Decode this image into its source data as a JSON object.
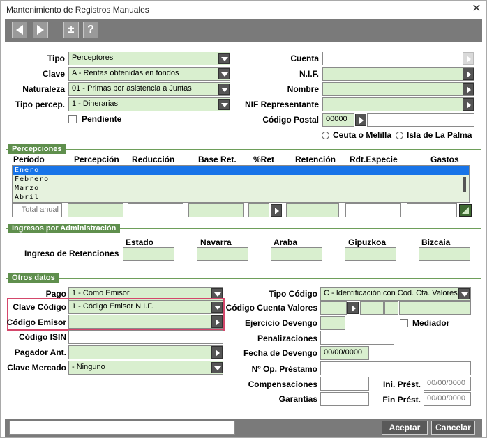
{
  "window": {
    "title": "Mantenimiento de Registros Manuales",
    "close_glyph": "✕"
  },
  "toolbar": {
    "prev_icon": "arrow-left-icon",
    "next_icon": "arrow-right-icon",
    "plusminus_label": "±",
    "help_label": "?"
  },
  "header": {
    "tipo": {
      "label": "Tipo",
      "value": "Perceptores"
    },
    "clave": {
      "label": "Clave",
      "value": "A - Rentas obtenidas en fondos"
    },
    "naturaleza": {
      "label": "Naturaleza",
      "value": "01 - Primas por asistencia a Juntas"
    },
    "tipo_percep": {
      "label": "Tipo percep.",
      "value": "1 - Dinerarias"
    },
    "pendiente": {
      "label": "Pendiente",
      "checked": false
    },
    "cuenta": {
      "label": "Cuenta",
      "value": ""
    },
    "nif": {
      "label": "N.I.F.",
      "value": ""
    },
    "nombre": {
      "label": "Nombre",
      "value": ""
    },
    "nif_representante": {
      "label": "NIF Representante",
      "value": ""
    },
    "codigo_postal": {
      "label": "Código Postal",
      "value": "00000",
      "extra": ""
    },
    "ceuta": {
      "label": "Ceuta o Melilla"
    },
    "palma": {
      "label": "Isla de La Palma"
    }
  },
  "percepciones": {
    "section_label": "Percepciones",
    "columns": [
      "Período",
      "Percepción",
      "Reducción",
      "Base Ret.",
      "%Ret",
      "Retención",
      "Rdt.Especie",
      "Gastos"
    ],
    "periods": [
      "Enero",
      "Febrero",
      "Marzo",
      "Abril"
    ],
    "selected_index": 0,
    "total_label": "Total anual"
  },
  "ingresos": {
    "section_label": "Ingresos por Administración",
    "row_label": "Ingreso de Retenciones",
    "columns": [
      "Estado",
      "Navarra",
      "Araba",
      "Gipuzkoa",
      "Bizcaia"
    ]
  },
  "otros": {
    "section_label": "Otros datos",
    "pago": {
      "label": "Pago",
      "value": "1 - Como Emisor"
    },
    "clave_codigo": {
      "label": "Clave Código",
      "value": "1 - Código Emisor N.I.F."
    },
    "codigo_emisor": {
      "label": "Código Emisor",
      "value": ""
    },
    "codigo_isin": {
      "label": "Código ISIN",
      "value": ""
    },
    "pagador_ant": {
      "label": "Pagador Ant.",
      "value": ""
    },
    "clave_mercado": {
      "label": "Clave Mercado",
      "value": "- Ninguno"
    },
    "tipo_codigo": {
      "label": "Tipo Código",
      "value": "C - Identificación con Cód. Cta. Valores"
    },
    "codigo_cuenta_valores": {
      "label": "Código Cuenta Valores"
    },
    "ejercicio_devengo": {
      "label": "Ejercicio Devengo",
      "value": ""
    },
    "mediador": {
      "label": "Mediador",
      "checked": false
    },
    "penalizaciones": {
      "label": "Penalizaciones",
      "value": ""
    },
    "fecha_devengo": {
      "label": "Fecha de Devengo",
      "value": "00/00/0000"
    },
    "num_op_prestamo": {
      "label": "Nº Op. Préstamo",
      "value": ""
    },
    "compensaciones": {
      "label": "Compensaciones",
      "value": ""
    },
    "garantias": {
      "label": "Garantías",
      "value": ""
    },
    "ini_prest": {
      "label": "Ini. Prést.",
      "value": "00/00/0000"
    },
    "fin_prest": {
      "label": "Fin Prést.",
      "value": "00/00/0000"
    }
  },
  "footer": {
    "status_value": "",
    "accept_label": "Aceptar",
    "cancel_label": "Cancelar"
  }
}
